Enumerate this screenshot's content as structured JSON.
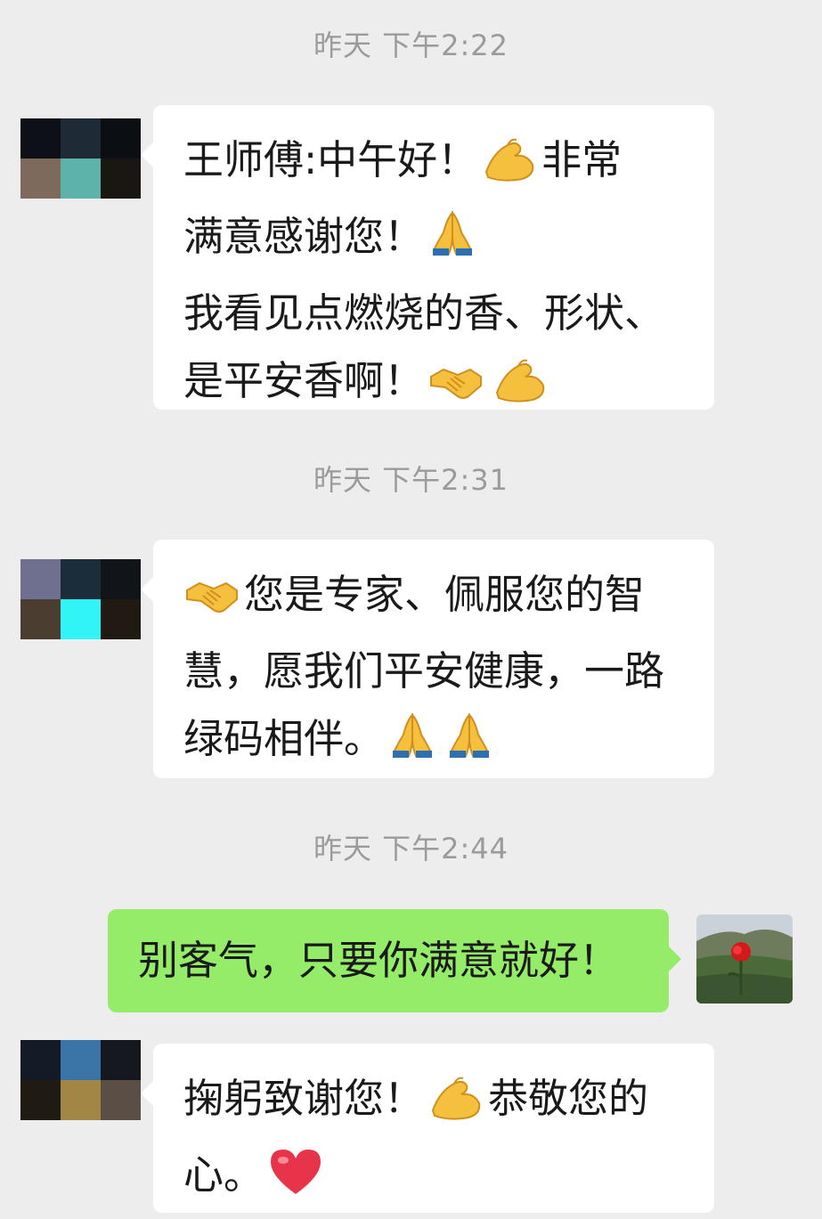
{
  "chat": {
    "messages": [
      {
        "time": "昨天 下午2:22",
        "sender": "other",
        "lines": [
          "王师傅:中午好！",
          "非常",
          "满意感谢您！",
          "我看见点燃烧的香、形状、",
          "是平安香啊！"
        ],
        "avatar_colors": [
          "#0d1117",
          "#1e2a35",
          "#0b0f14",
          "#7d6a5c",
          "#5db3aa",
          "#1a1612"
        ]
      },
      {
        "time": "昨天 下午2:31",
        "sender": "other",
        "lines": [
          "您是专家、佩服您的智",
          "慧，愿我们平安健康，一路",
          "绿码相伴。"
        ],
        "avatar_colors": [
          "#6f6f8f",
          "#1b2d3a",
          "#111418",
          "#4b3e31",
          "#31f4f7",
          "#201a12"
        ]
      },
      {
        "time": "昨天 下午2:44",
        "sender": "self",
        "lines": [
          "别客气，只要你满意就好！"
        ]
      },
      {
        "sender": "other",
        "lines": [
          "掬躬致谢您！",
          "恭敬您的",
          "心。"
        ],
        "avatar_colors": [
          "#141b26",
          "#3b74a6",
          "#15191f",
          "#1f1a13",
          "#a18645",
          "#5b4f45"
        ]
      }
    ]
  },
  "icons": {
    "ok_hand": "ok-hand-icon",
    "pray": "folded-hands-icon",
    "handshake": "handshake-icon",
    "heart": "heart-icon",
    "self_avatar": "rose-landscape-photo"
  }
}
